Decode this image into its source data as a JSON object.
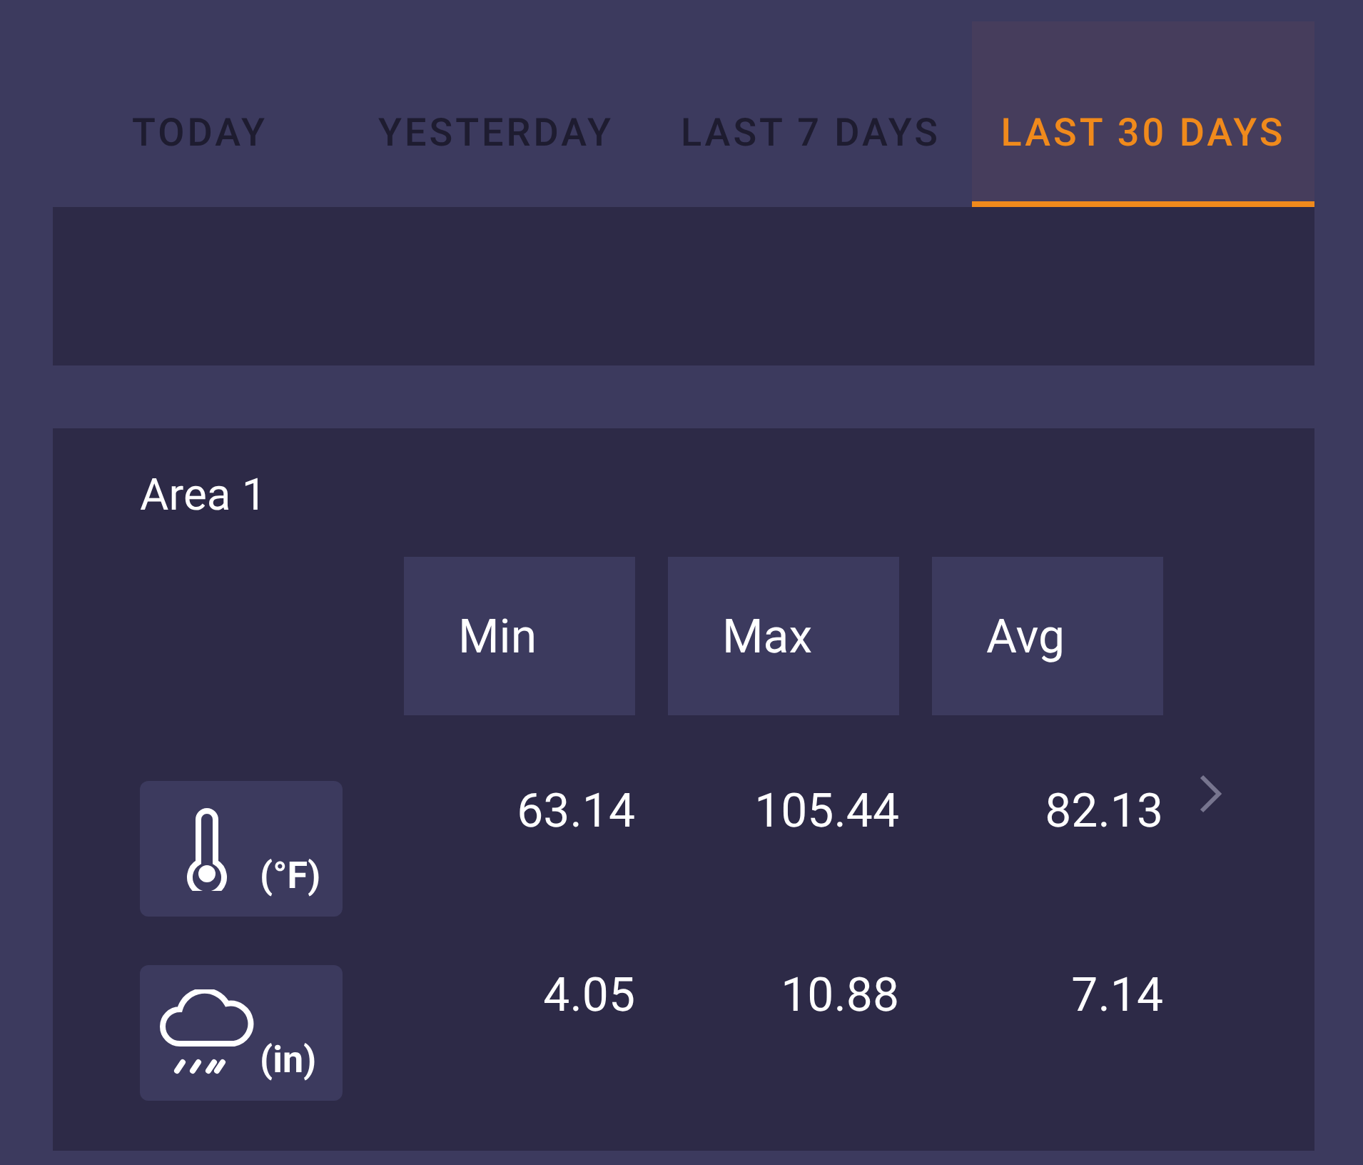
{
  "tabs": [
    {
      "label": "TODAY",
      "selected": false
    },
    {
      "label": "YESTERDAY",
      "selected": false
    },
    {
      "label": "LAST 7 DAYS",
      "selected": false
    },
    {
      "label": "LAST 30 DAYS",
      "selected": true
    }
  ],
  "area": {
    "title": "Area 1",
    "columns": [
      "Min",
      "Max",
      "Avg"
    ],
    "rows": [
      {
        "kind": "temperature",
        "unit": "(°F)",
        "values": [
          "63.14",
          "105.44",
          "82.13"
        ]
      },
      {
        "kind": "rain",
        "unit": "(in)",
        "values": [
          "4.05",
          "10.88",
          "7.14"
        ]
      }
    ]
  }
}
